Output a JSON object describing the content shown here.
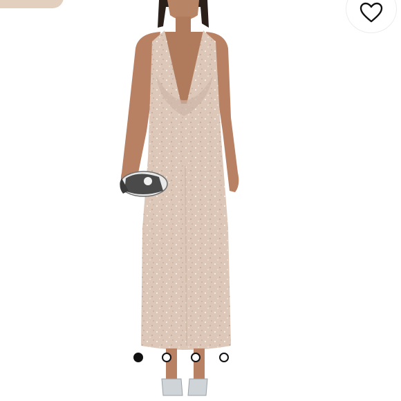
{
  "product": {
    "image_alt": "",
    "dress_color": "#dcc7b8",
    "background": "#ffffff"
  },
  "favorite": {
    "icon": "heart-outline-icon"
  },
  "carousel": {
    "total_images": 4,
    "active_index": 0
  }
}
